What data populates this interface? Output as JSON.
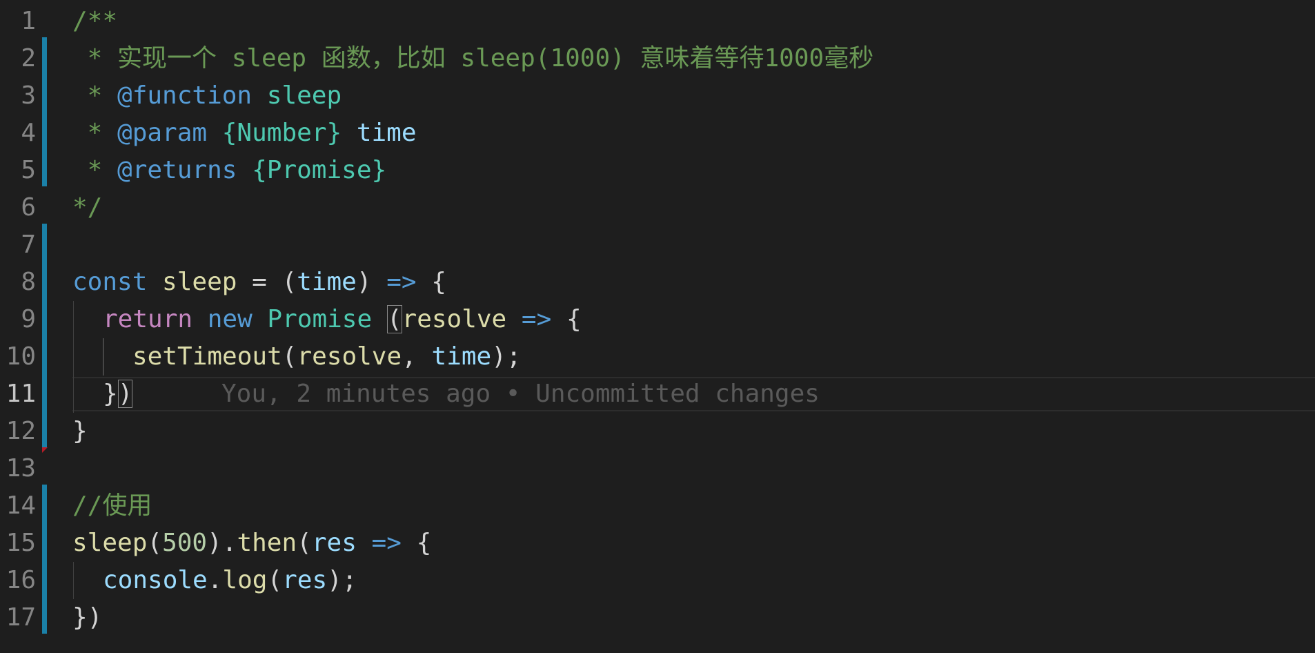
{
  "lines": [
    {
      "num": "1"
    },
    {
      "num": "2"
    },
    {
      "num": "3"
    },
    {
      "num": "4"
    },
    {
      "num": "5"
    },
    {
      "num": "6"
    },
    {
      "num": "7"
    },
    {
      "num": "8"
    },
    {
      "num": "9"
    },
    {
      "num": "10"
    },
    {
      "num": "11"
    },
    {
      "num": "12"
    },
    {
      "num": "13"
    },
    {
      "num": "14"
    },
    {
      "num": "15"
    },
    {
      "num": "16"
    },
    {
      "num": "17"
    }
  ],
  "code": {
    "l1": "/**",
    "l2": " * 实现一个 sleep 函数，比如 sleep(1000) 意味着等待1000毫秒",
    "l3_star": " * ",
    "l3_tag": "@function",
    "l3_name": " sleep",
    "l4_star": " * ",
    "l4_tag": "@param",
    "l4_type": " {Number}",
    "l4_name": " time",
    "l5_star": " * ",
    "l5_tag": "@returns",
    "l5_type": " {Promise}",
    "l6": "*/",
    "l8_kw": "const",
    "l8_name": " sleep",
    "l8_eq": " = (",
    "l8_param": "time",
    "l8_close": ") ",
    "l8_arrow": "=>",
    "l8_brace": " {",
    "l9_kw": "return",
    "l9_new": " new",
    "l9_cls": " Promise ",
    "l9_paren": "(",
    "l9_param": "resolve",
    "l9_arrow": " =>",
    "l9_brace": " {",
    "l10_fn": "setTimeout",
    "l10_open": "(",
    "l10_arg1": "resolve",
    "l10_comma": ", ",
    "l10_arg2": "time",
    "l10_close": ");",
    "l11_brace": "}",
    "l11_paren": ")",
    "l11_blame": "You, 2 minutes ago • Uncommitted changes",
    "l12": "}",
    "l14": "//使用",
    "l15_fn": "sleep",
    "l15_open": "(",
    "l15_num": "500",
    "l15_close": ").",
    "l15_then": "then",
    "l15_open2": "(",
    "l15_param": "res",
    "l15_arrow": " =>",
    "l15_brace": " {",
    "l16_obj": "console",
    "l16_dot": ".",
    "l16_fn": "log",
    "l16_open": "(",
    "l16_arg": "res",
    "l16_close": ");",
    "l17": "})"
  },
  "colors": {
    "background": "#1e1e1e",
    "comment": "#6a9955",
    "keyword": "#569cd6",
    "control": "#c586c0",
    "function": "#dcdcaa",
    "type": "#4ec9b0",
    "variable": "#9cdcfe",
    "number": "#b5cea8",
    "gutter_modified": "#1b81a8"
  }
}
